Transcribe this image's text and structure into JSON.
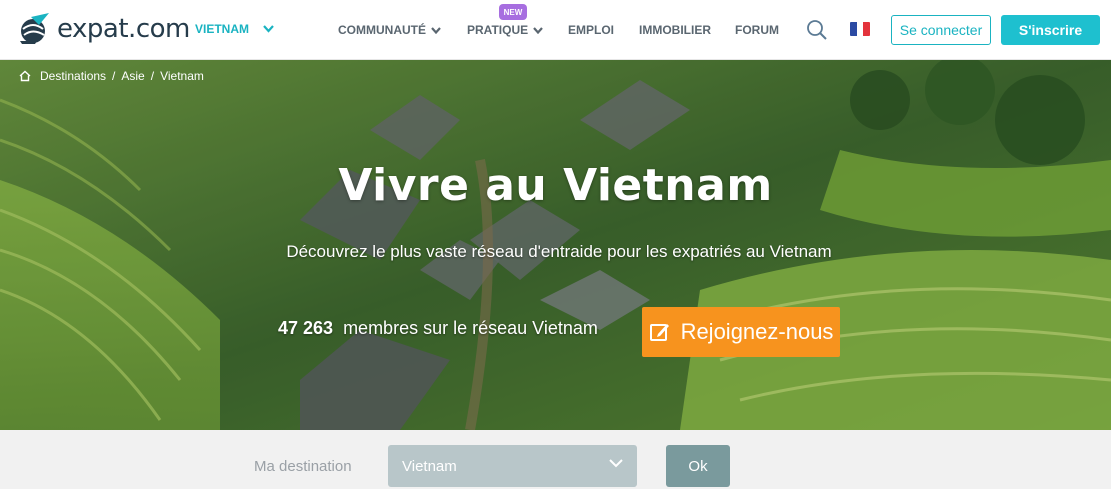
{
  "header": {
    "logo_text": "expat.com",
    "country": "VIETNAM",
    "nav": {
      "community": "COMMUNAUTÉ",
      "practical": "PRATIQUE",
      "practical_badge": "NEW",
      "jobs": "EMPLOI",
      "real_estate": "IMMOBILIER",
      "forum": "FORUM"
    },
    "login_label": "Se connecter",
    "signup_label": "S'inscrire",
    "language_flag": "france-flag"
  },
  "breadcrumb": {
    "items": [
      "Destinations",
      "Asie",
      "Vietnam"
    ],
    "separator": "/"
  },
  "hero": {
    "title": "Vivre au Vietnam",
    "subtitle": "Découvrez le plus vaste réseau d'entraide pour les expatriés au Vietnam",
    "member_count": "47 263",
    "member_text": "membres sur le réseau Vietnam",
    "join_label": "Rejoignez-nous"
  },
  "destination": {
    "label": "Ma destination",
    "selected": "Vietnam",
    "ok_label": "Ok"
  },
  "colors": {
    "accent": "#1ab3c1",
    "signup_bg": "#1ec0cf",
    "join_bg": "#f7931e",
    "badge_bg": "#a76ee0"
  }
}
